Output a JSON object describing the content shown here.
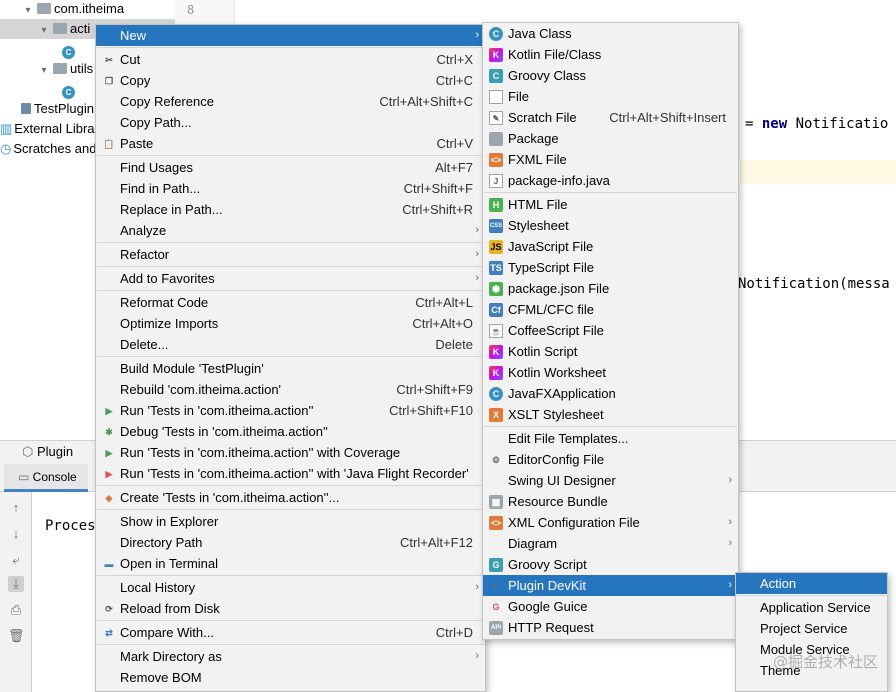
{
  "gutter": {
    "line_number": "8"
  },
  "project_tree": [
    {
      "label": "com.itheima",
      "indent": 22,
      "kind": "folder",
      "chevron": "▾"
    },
    {
      "label": "acti",
      "indent": 38,
      "kind": "folder",
      "chevron": "▾",
      "selected": true
    },
    {
      "label": "",
      "indent": 62,
      "kind": "class"
    },
    {
      "label": "utils",
      "indent": 38,
      "kind": "folder",
      "chevron": "▾"
    },
    {
      "label": "",
      "indent": 62,
      "kind": "class"
    },
    {
      "label": "TestPlugin",
      "indent": 18,
      "kind": "file"
    },
    {
      "label": "External Libra",
      "indent": 0,
      "kind": "lib"
    },
    {
      "label": "Scratches and",
      "indent": 0,
      "kind": "scratch"
    }
  ],
  "editor": {
    "line1_prefix": "= ",
    "line1_keyword": "new",
    "line1_suffix": " Notificatio",
    "line2": "Notification(messa"
  },
  "tool_window": {
    "tab_label": "Plugin",
    "console_tab": "Console",
    "console_text": "Proces"
  },
  "context_menu": [
    {
      "label": "New",
      "icon": "",
      "shortcut": "",
      "submenu": true,
      "highlighted": true
    },
    {
      "sep": true
    },
    {
      "label": "Cut",
      "icon": "scissors-icon",
      "shortcut": "Ctrl+X"
    },
    {
      "label": "Copy",
      "icon": "copy-icon",
      "shortcut": "Ctrl+C"
    },
    {
      "label": "Copy Reference",
      "icon": "",
      "shortcut": "Ctrl+Alt+Shift+C"
    },
    {
      "label": "Copy Path...",
      "icon": "",
      "shortcut": ""
    },
    {
      "label": "Paste",
      "icon": "clipboard-icon",
      "shortcut": "Ctrl+V"
    },
    {
      "sep": true
    },
    {
      "label": "Find Usages",
      "icon": "",
      "shortcut": "Alt+F7"
    },
    {
      "label": "Find in Path...",
      "icon": "",
      "shortcut": "Ctrl+Shift+F"
    },
    {
      "label": "Replace in Path...",
      "icon": "",
      "shortcut": "Ctrl+Shift+R"
    },
    {
      "label": "Analyze",
      "icon": "",
      "shortcut": "",
      "submenu": true
    },
    {
      "sep": true
    },
    {
      "label": "Refactor",
      "icon": "",
      "shortcut": "",
      "submenu": true
    },
    {
      "sep": true
    },
    {
      "label": "Add to Favorites",
      "icon": "",
      "shortcut": "",
      "submenu": true
    },
    {
      "sep": true
    },
    {
      "label": "Reformat Code",
      "icon": "",
      "shortcut": "Ctrl+Alt+L"
    },
    {
      "label": "Optimize Imports",
      "icon": "",
      "shortcut": "Ctrl+Alt+O"
    },
    {
      "label": "Delete...",
      "icon": "",
      "shortcut": "Delete"
    },
    {
      "sep": true
    },
    {
      "label": "Build Module 'TestPlugin'",
      "icon": "",
      "shortcut": ""
    },
    {
      "label": "Rebuild 'com.itheima.action'",
      "icon": "",
      "shortcut": "Ctrl+Shift+F9"
    },
    {
      "label": "Run 'Tests in 'com.itheima.action''",
      "icon": "run-icon",
      "shortcut": "Ctrl+Shift+F10"
    },
    {
      "label": "Debug 'Tests in 'com.itheima.action''",
      "icon": "debug-icon",
      "shortcut": ""
    },
    {
      "label": "Run 'Tests in 'com.itheima.action'' with Coverage",
      "icon": "coverage-icon",
      "shortcut": ""
    },
    {
      "label": "Run 'Tests in 'com.itheima.action'' with 'Java Flight Recorder'",
      "icon": "flight-recorder-icon",
      "shortcut": ""
    },
    {
      "sep": true
    },
    {
      "label": "Create 'Tests in 'com.itheima.action''...",
      "icon": "create-test-icon",
      "shortcut": ""
    },
    {
      "sep": true
    },
    {
      "label": "Show in Explorer",
      "icon": "",
      "shortcut": ""
    },
    {
      "label": "Directory Path",
      "icon": "",
      "shortcut": "Ctrl+Alt+F12"
    },
    {
      "label": "Open in Terminal",
      "icon": "terminal-icon",
      "shortcut": ""
    },
    {
      "sep": true
    },
    {
      "label": "Local History",
      "icon": "",
      "shortcut": "",
      "submenu": true
    },
    {
      "label": "Reload from Disk",
      "icon": "reload-icon",
      "shortcut": ""
    },
    {
      "sep": true
    },
    {
      "label": "Compare With...",
      "icon": "compare-icon",
      "shortcut": "Ctrl+D"
    },
    {
      "sep": true
    },
    {
      "label": "Mark Directory as",
      "icon": "",
      "shortcut": "",
      "submenu": true
    },
    {
      "label": "Remove BOM",
      "icon": "",
      "shortcut": ""
    }
  ],
  "new_menu": [
    {
      "label": "Java Class",
      "icon": "java-class-icon",
      "glyph": "C",
      "style": "c-circle"
    },
    {
      "label": "Kotlin File/Class",
      "icon": "kotlin-file-icon",
      "glyph": "K",
      "style": "k-icon"
    },
    {
      "label": "Groovy Class",
      "icon": "groovy-class-icon",
      "glyph": "C",
      "style": "teal"
    },
    {
      "label": "File",
      "icon": "file-icon",
      "glyph": "",
      "style": "file-ic"
    },
    {
      "label": "Scratch File",
      "icon": "scratch-file-icon",
      "glyph": "✎",
      "style": "file-ic",
      "shortcut": "Ctrl+Alt+Shift+Insert"
    },
    {
      "label": "Package",
      "icon": "package-icon",
      "glyph": "",
      "style": "sq"
    },
    {
      "label": "FXML File",
      "icon": "fxml-file-icon",
      "glyph": "<>",
      "style": "orange"
    },
    {
      "label": "package-info.java",
      "icon": "package-info-icon",
      "glyph": "J",
      "style": "file-ic"
    },
    {
      "sep": true
    },
    {
      "label": "HTML File",
      "icon": "html-file-icon",
      "glyph": "H",
      "style": "green"
    },
    {
      "label": "Stylesheet",
      "icon": "stylesheet-icon",
      "glyph": "CSS",
      "style": "blue"
    },
    {
      "label": "JavaScript File",
      "icon": "javascript-file-icon",
      "glyph": "JS",
      "style": "yellow"
    },
    {
      "label": "TypeScript File",
      "icon": "typescript-file-icon",
      "glyph": "TS",
      "style": "blue"
    },
    {
      "label": "package.json File",
      "icon": "package-json-icon",
      "glyph": "⬢",
      "style": "green"
    },
    {
      "label": "CFML/CFC file",
      "icon": "cfml-file-icon",
      "glyph": "Cf",
      "style": "blue"
    },
    {
      "label": "CoffeeScript File",
      "icon": "coffeescript-file-icon",
      "glyph": "☕",
      "style": "file-ic"
    },
    {
      "label": "Kotlin Script",
      "icon": "kotlin-script-icon",
      "glyph": "K",
      "style": "k-icon"
    },
    {
      "label": "Kotlin Worksheet",
      "icon": "kotlin-worksheet-icon",
      "glyph": "K",
      "style": "k-icon"
    },
    {
      "label": "JavaFXApplication",
      "icon": "javafx-icon",
      "glyph": "C",
      "style": "c-circle"
    },
    {
      "label": "XSLT Stylesheet",
      "icon": "xslt-icon",
      "glyph": "X",
      "style": "orange"
    },
    {
      "sep": true
    },
    {
      "label": "Edit File Templates...",
      "icon": "",
      "glyph": "",
      "style": ""
    },
    {
      "label": "EditorConfig File",
      "icon": "editorconfig-icon",
      "glyph": "⚙",
      "style": "gray-ic"
    },
    {
      "label": "Swing UI Designer",
      "icon": "",
      "glyph": "",
      "style": "",
      "submenu": true
    },
    {
      "label": "Resource Bundle",
      "icon": "resource-bundle-icon",
      "glyph": "▦",
      "style": "sq"
    },
    {
      "label": "XML Configuration File",
      "icon": "xml-config-icon",
      "glyph": "<>",
      "style": "orange",
      "submenu": true
    },
    {
      "label": "Diagram",
      "icon": "",
      "glyph": "",
      "style": "",
      "submenu": true
    },
    {
      "label": "Groovy Script",
      "icon": "groovy-script-icon",
      "glyph": "G",
      "style": "teal"
    },
    {
      "label": "Plugin DevKit",
      "icon": "plugin-devkit-icon",
      "glyph": "◐",
      "style": "gray-ic",
      "submenu": true,
      "highlighted": true
    },
    {
      "label": "Google Guice",
      "icon": "google-guice-icon",
      "glyph": "G",
      "style": "red-ic"
    },
    {
      "label": "HTTP Request",
      "icon": "http-request-icon",
      "glyph": "API",
      "style": "sq"
    }
  ],
  "devkit_menu": [
    {
      "label": "Action",
      "highlighted": true
    },
    {
      "sep": true
    },
    {
      "label": "Application Service"
    },
    {
      "label": "Project Service"
    },
    {
      "label": "Module Service"
    },
    {
      "label": "Theme"
    }
  ],
  "watermark": "@掘金技术社区"
}
